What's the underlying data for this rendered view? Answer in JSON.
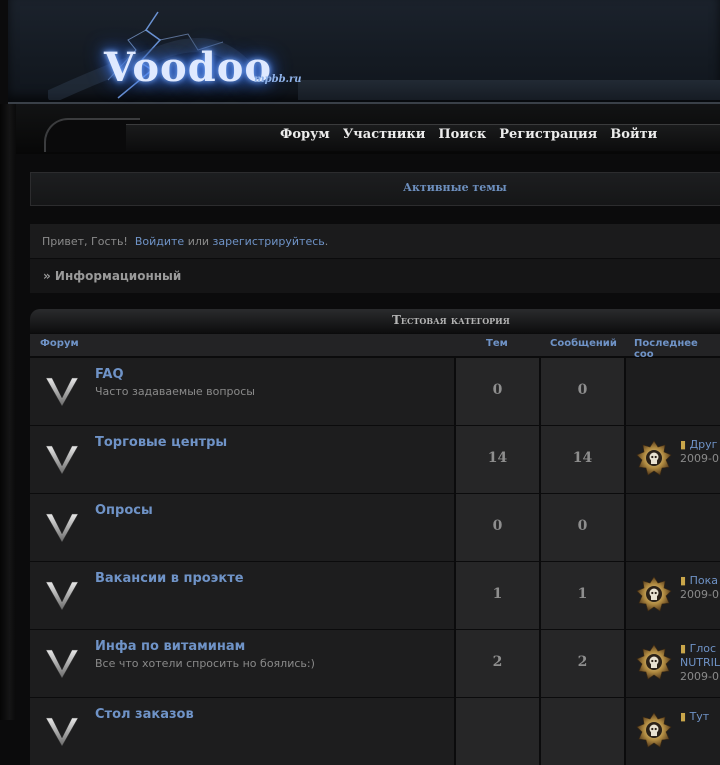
{
  "header": {
    "logo_text": "Voodoo",
    "logo_sub": "mpbb.ru"
  },
  "nav": {
    "items": [
      "Форум",
      "Участники",
      "Поиск",
      "Регистрация",
      "Войти"
    ]
  },
  "active_topics": "Активные темы",
  "greeting": {
    "hello": "Привет, Гость!",
    "login": "Войдите",
    "or": "или",
    "register": "зарегистрируйтесь",
    "end": "."
  },
  "breadcrumb": "» Информационный",
  "category": {
    "title": "Тестовая категория",
    "columns": {
      "forum": "Форум",
      "topics": "Тем",
      "posts": "Сообщений",
      "last": "Последнее соо"
    },
    "forums": [
      {
        "title": "FAQ",
        "desc": "Часто задаваемые вопросы",
        "topics": "0",
        "posts": "0",
        "last": null
      },
      {
        "title": "Торговые центры",
        "desc": "",
        "topics": "14",
        "posts": "14",
        "last": {
          "line1": "Друг",
          "line2": "2009-0",
          "line3": ""
        }
      },
      {
        "title": "Опросы",
        "desc": "",
        "topics": "0",
        "posts": "0",
        "last": null
      },
      {
        "title": "Вакансии в проэкте",
        "desc": "",
        "topics": "1",
        "posts": "1",
        "last": {
          "line1": "Пока",
          "line2": "2009-0",
          "line3": ""
        }
      },
      {
        "title": "Инфа по витаминам",
        "desc": "Все что хотели спросить но боялись:)",
        "topics": "2",
        "posts": "2",
        "last": {
          "line1": "Глос",
          "line2": "NUTRIL",
          "line3": "2009-0"
        }
      },
      {
        "title": "Стол заказов",
        "desc": "",
        "topics": "",
        "posts": "",
        "last": {
          "line1": "Тут",
          "line2": "",
          "line3": ""
        }
      }
    ]
  }
}
